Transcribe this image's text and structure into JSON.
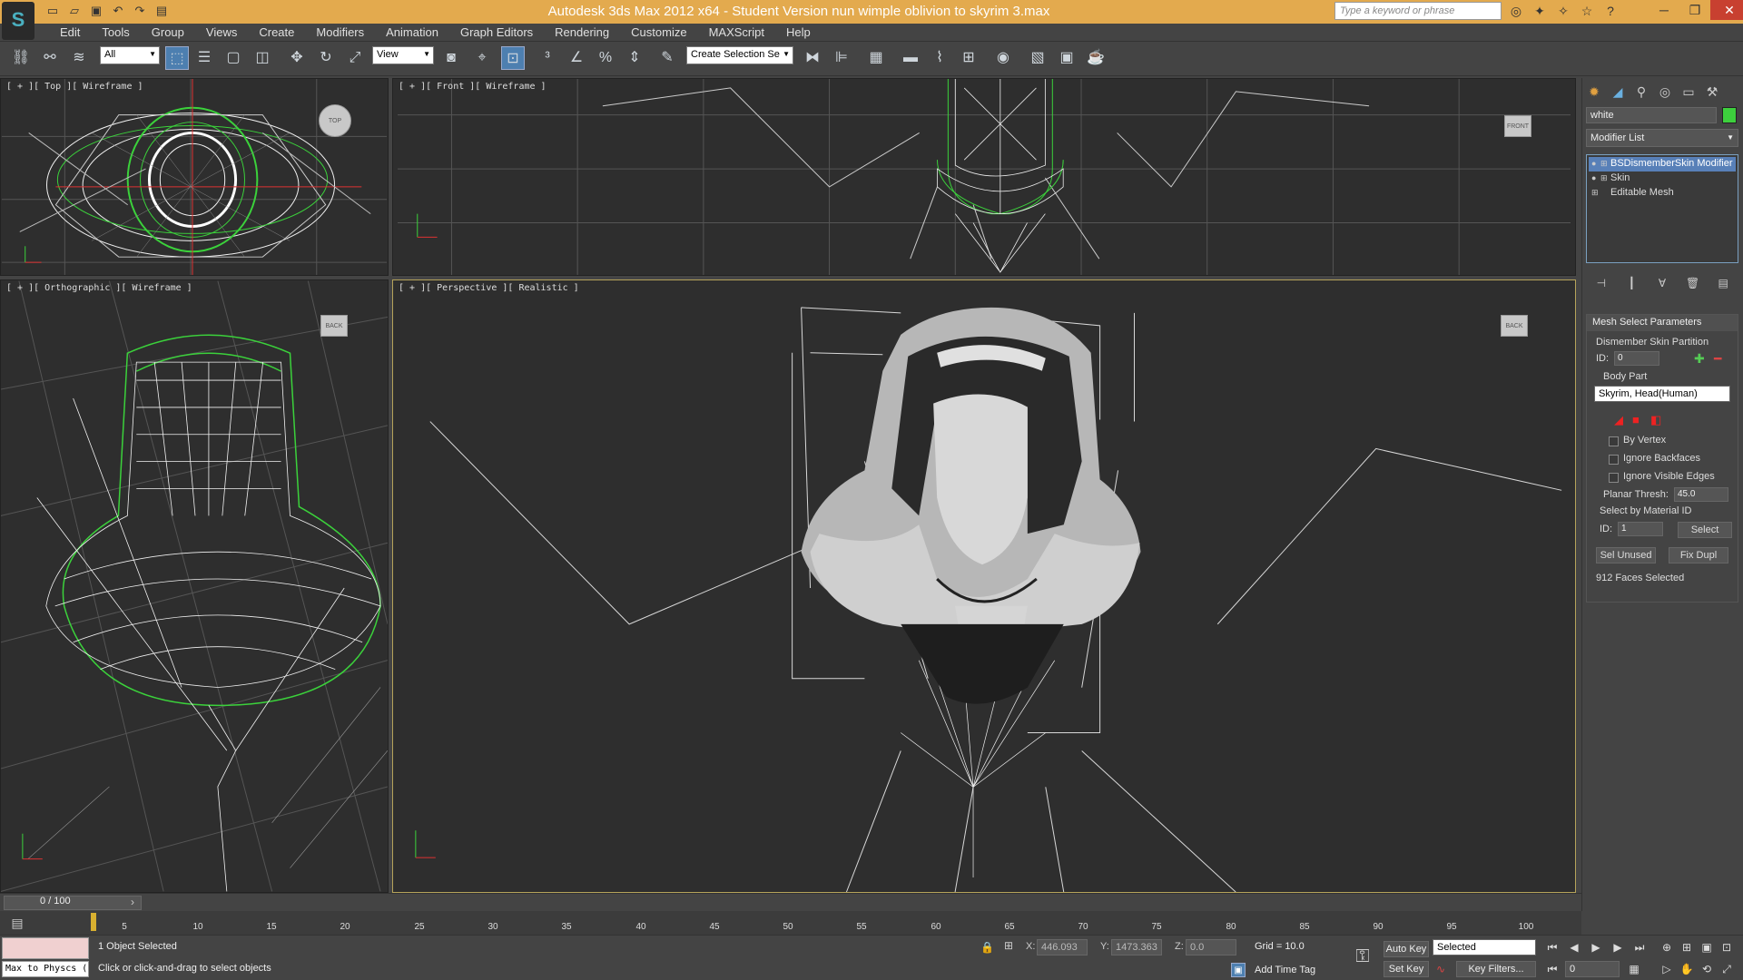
{
  "app": {
    "title": "Autodesk 3ds Max  2012 x64  - Student Version    nun wimple oblivion to skyrim 3.max",
    "logo": "S",
    "search_placeholder": "Type a keyword or phrase"
  },
  "menu": [
    "Edit",
    "Tools",
    "Group",
    "Views",
    "Create",
    "Modifiers",
    "Animation",
    "Graph Editors",
    "Rendering",
    "Customize",
    "MAXScript",
    "Help"
  ],
  "toolbar": {
    "filter": "All",
    "ref_coord": "View",
    "named_selection": "Create Selection Se"
  },
  "viewports": {
    "top": {
      "label": "[ + ][ Top ][ Wireframe ]",
      "navcube": "TOP"
    },
    "front": {
      "label": "[ + ][ Front ][ Wireframe ]",
      "navcube": "FRONT"
    },
    "ortho": {
      "label": "[ + ][ Orthographic ][ Wireframe ]",
      "navcube": "BACK"
    },
    "persp": {
      "label": "[ + ][ Perspective ][ Realistic ]",
      "navcube": "BACK"
    }
  },
  "command_panel": {
    "object_name": "white",
    "object_color": "#3dd03d",
    "modifier_list": "Modifier List",
    "stack": [
      "BSDismemberSkin Modifier",
      "Skin",
      "Editable Mesh"
    ],
    "rollout": {
      "title": "Mesh Select Parameters",
      "partition_label": "Dismember Skin Partition",
      "id_label": "ID:",
      "id_value": "0",
      "body_part_label": "Body Part",
      "body_part_value": "Skyrim, Head(Human)",
      "by_vertex": "By Vertex",
      "ignore_backfaces": "Ignore Backfaces",
      "ignore_visible_edges": "Ignore Visible Edges",
      "planar_thresh_label": "Planar Thresh:",
      "planar_thresh_value": "45.0",
      "select_by_material": "Select by Material ID",
      "mat_id_label": "ID:",
      "mat_id_value": "1",
      "select_button": "Select",
      "sel_unused_button": "Sel Unused",
      "fix_dupl_button": "Fix Dupl",
      "faces_selected": "912 Faces Selected"
    }
  },
  "timeline": {
    "frame": "0 / 100",
    "ticks": [
      "5",
      "10",
      "15",
      "20",
      "25",
      "30",
      "35",
      "40",
      "45",
      "50",
      "55",
      "60",
      "65",
      "70",
      "75",
      "80",
      "85",
      "90",
      "95",
      "100"
    ]
  },
  "status": {
    "maxscript_output": "Max to Physcs (",
    "selection": "1 Object Selected",
    "prompt": "Click or click-and-drag to select objects",
    "x_label": "X:",
    "x_value": "446.093",
    "y_label": "Y:",
    "y_value": "1473.363",
    "z_label": "Z:",
    "z_value": "0.0",
    "grid": "Grid = 10.0",
    "add_time_tag": "Add Time Tag",
    "auto_key": "Auto Key",
    "set_key": "Set Key",
    "selected_dropdown": "Selected",
    "key_filters": "Key Filters...",
    "current_frame": "0"
  }
}
